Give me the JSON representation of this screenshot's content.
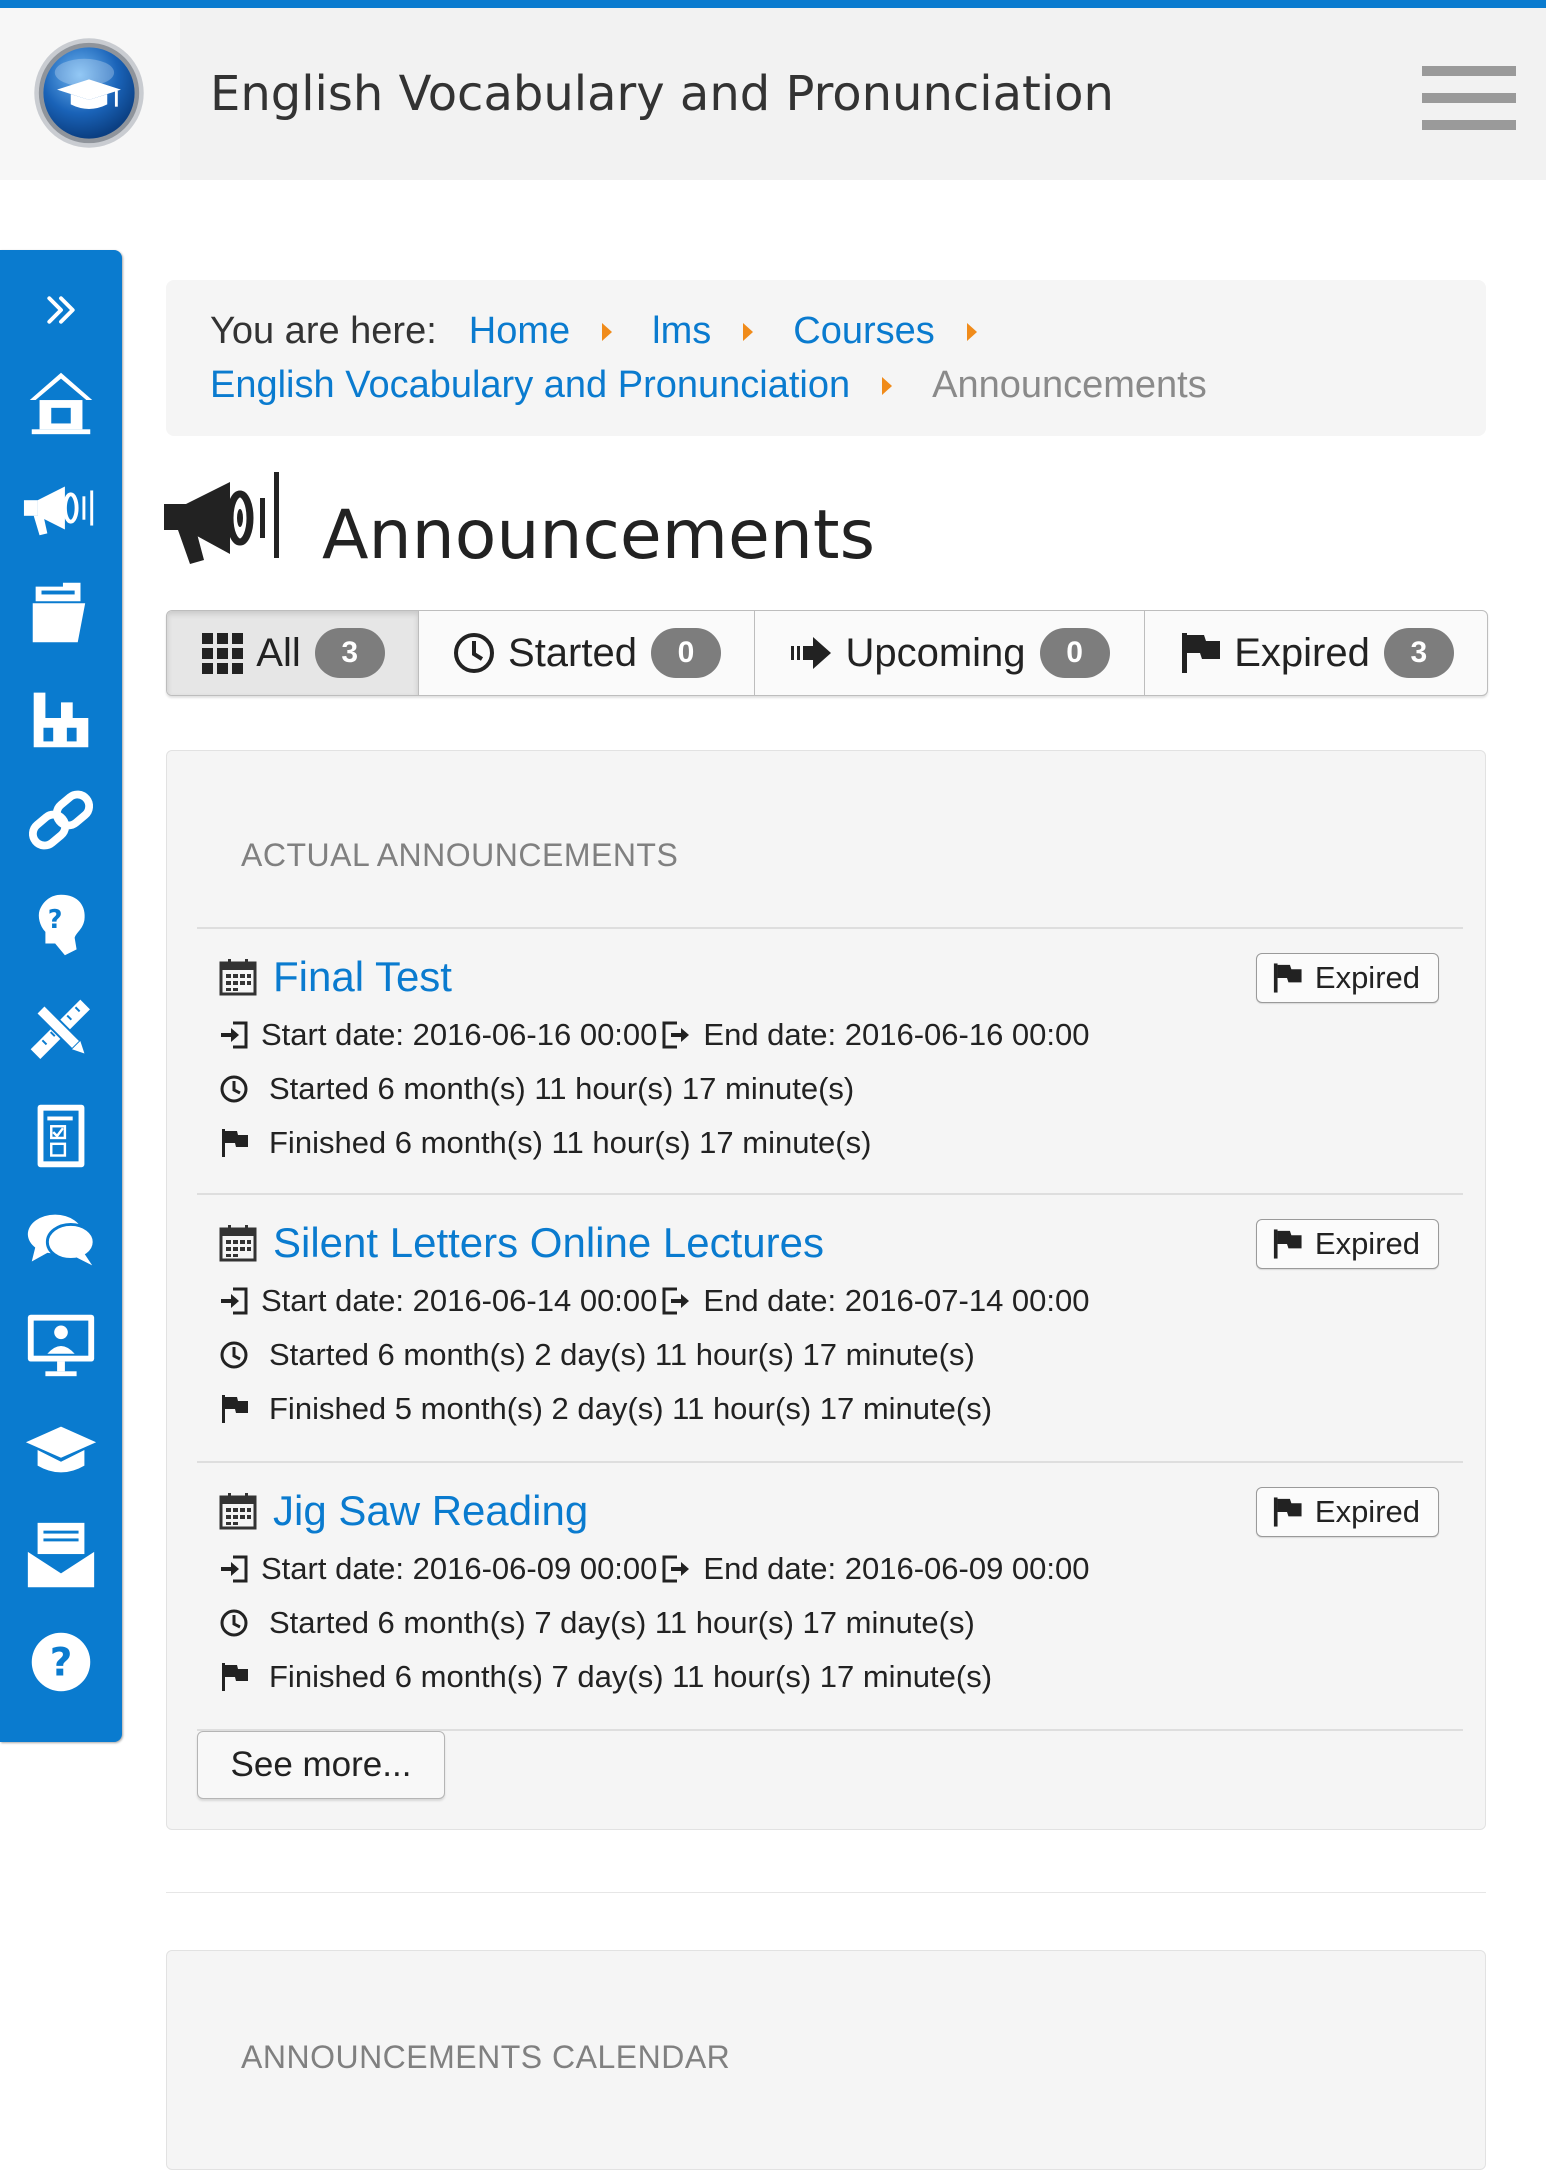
{
  "header": {
    "title": "English Vocabulary and Pronunciation"
  },
  "colors": {
    "brand": "#0a7bcf",
    "accent": "#f08b1a",
    "badge": "#7d7d7d"
  },
  "sidebar": {
    "items": [
      {
        "icon": "double-chevron-right-icon"
      },
      {
        "icon": "home-icon"
      },
      {
        "icon": "megaphone-icon"
      },
      {
        "icon": "folder-icon"
      },
      {
        "icon": "sitemap-icon"
      },
      {
        "icon": "link-icon"
      },
      {
        "icon": "question-head-icon"
      },
      {
        "icon": "pencil-ruler-icon"
      },
      {
        "icon": "checklist-icon"
      },
      {
        "icon": "chat-bubbles-icon"
      },
      {
        "icon": "presentation-monitor-icon"
      },
      {
        "icon": "graduation-cap-icon"
      },
      {
        "icon": "envelope-icon"
      },
      {
        "icon": "help-icon"
      }
    ]
  },
  "breadcrumb": {
    "label": "You are here:",
    "items": [
      "Home",
      "lms",
      "Courses",
      "English Vocabulary and Pronunciation"
    ],
    "current": "Announcements"
  },
  "page": {
    "title": "Announcements"
  },
  "tabs": [
    {
      "label": "All",
      "count": "3",
      "active": true,
      "icon": "grid-icon"
    },
    {
      "label": "Started",
      "count": "0",
      "active": false,
      "icon": "clock-icon"
    },
    {
      "label": "Upcoming",
      "count": "0",
      "active": false,
      "icon": "arrow-right-icon"
    },
    {
      "label": "Expired",
      "count": "3",
      "active": false,
      "icon": "flag-icon"
    }
  ],
  "actual": {
    "heading": "ACTUAL ANNOUNCEMENTS",
    "items": [
      {
        "title": "Final Test",
        "status": "Expired",
        "start": "Start date: 2016-06-16 00:00",
        "end": "End date: 2016-06-16 00:00",
        "started": "Started 6 month(s) 11 hour(s) 17 minute(s)",
        "finished": "Finished 6 month(s) 11 hour(s) 17 minute(s)"
      },
      {
        "title": "Silent Letters Online Lectures",
        "status": "Expired",
        "start": "Start date: 2016-06-14 00:00",
        "end": "End date: 2016-07-14 00:00",
        "started": "Started 6 month(s) 2 day(s) 11 hour(s) 17 minute(s)",
        "finished": "Finished 5 month(s) 2 day(s) 11 hour(s) 17 minute(s)"
      },
      {
        "title": "Jig Saw Reading",
        "status": "Expired",
        "start": "Start date: 2016-06-09 00:00",
        "end": "End date: 2016-06-09 00:00",
        "started": "Started 6 month(s) 7 day(s) 11 hour(s) 17 minute(s)",
        "finished": "Finished 6 month(s) 7 day(s) 11 hour(s) 17 minute(s)"
      }
    ],
    "see_more": "See more..."
  },
  "calendar": {
    "heading": "ANNOUNCEMENTS CALENDAR"
  }
}
